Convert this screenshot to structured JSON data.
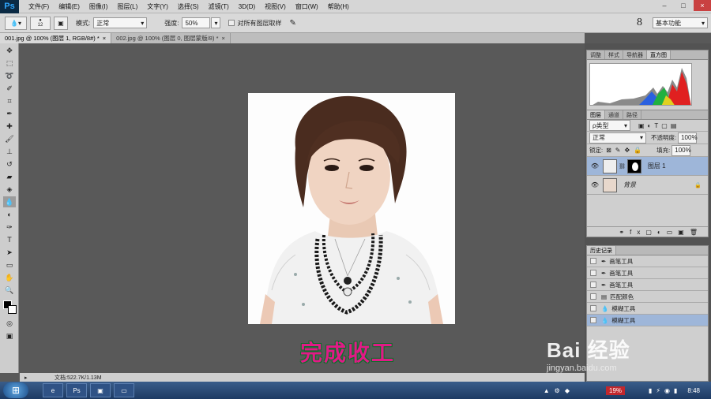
{
  "app": {
    "logo": "Ps"
  },
  "menu": [
    "文件(F)",
    "编辑(E)",
    "图像(I)",
    "图层(L)",
    "文字(Y)",
    "选择(S)",
    "滤镜(T)",
    "3D(D)",
    "视图(V)",
    "窗口(W)",
    "帮助(H)"
  ],
  "window_controls": {
    "minimize": "–",
    "maximize": "□",
    "close": "×"
  },
  "options": {
    "brush_size": "12",
    "mode_label": "模式:",
    "mode_value": "正常",
    "strength_label": "强度:",
    "strength_value": "50%",
    "sample_all_label": "对所有图层取样",
    "workspace_number": "8",
    "workspace_value": "基本功能"
  },
  "doc_tabs": [
    {
      "label": "001.jpg @ 100% (图层 1, RGB/8#) *",
      "close": "×"
    },
    {
      "label": "002.jpg @ 100% (图层 0, 图层蒙版/8) *",
      "close": "×"
    }
  ],
  "status": {
    "doc_info": "文档:522.7K/1.13M"
  },
  "caption": "完成收工",
  "panels": {
    "top_tabs": [
      "调整",
      "样式",
      "导航器",
      "直方图"
    ],
    "layers_tabs": [
      "图层",
      "通道",
      "路径"
    ],
    "filter_kind": "ρ类型",
    "blend_mode": "正常",
    "opacity_label": "不透明度:",
    "opacity_value": "100%",
    "lock_label": "锁定:",
    "fill_label": "填充:",
    "fill_value": "100%",
    "layers": [
      {
        "name": "图层 1",
        "active": true
      },
      {
        "name": "背景",
        "active": false
      }
    ],
    "history_title": "历史记录",
    "history": [
      {
        "name": "画笔工具",
        "icon": "brush-icon",
        "active": false
      },
      {
        "name": "画笔工具",
        "icon": "brush-icon",
        "active": false
      },
      {
        "name": "画笔工具",
        "icon": "brush-icon",
        "active": false
      },
      {
        "name": "匹配颜色",
        "icon": "match-color-icon",
        "active": false
      },
      {
        "name": "模糊工具",
        "icon": "blur-icon",
        "active": false
      },
      {
        "name": "模糊工具",
        "icon": "blur-icon",
        "active": true
      }
    ]
  },
  "watermark": {
    "main": "Bai 经验",
    "sub": "jingyan.baidu.com"
  },
  "taskbar": {
    "battery": "19%",
    "time": "8:48"
  }
}
